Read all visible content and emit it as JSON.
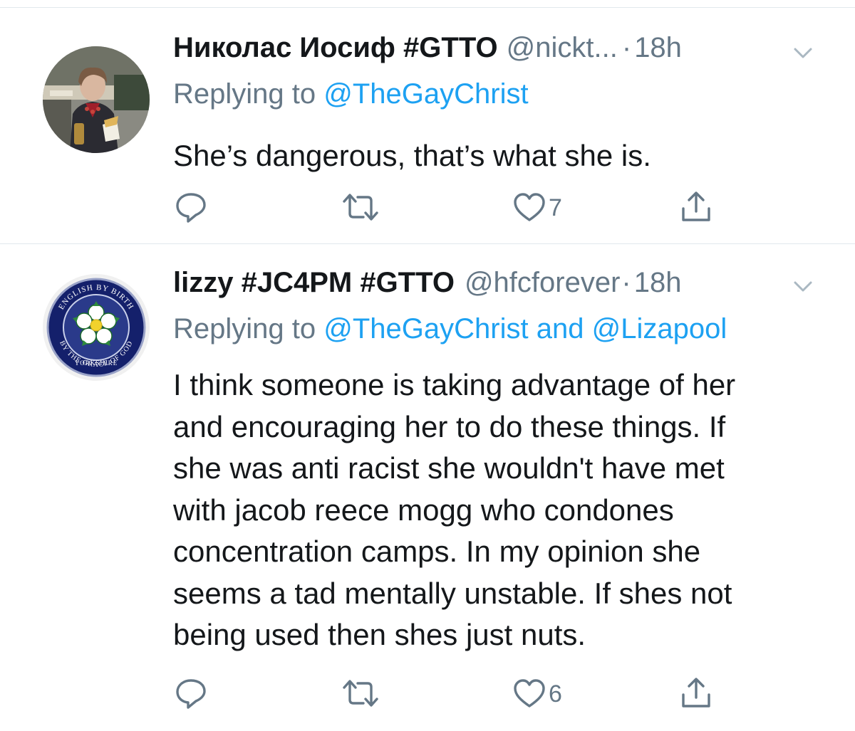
{
  "tweets": [
    {
      "display_name": "Николас Иосиф #GTTO",
      "handle": "@nickt...",
      "time": "18h",
      "reply_prefix": "Replying to",
      "mentions": [
        "@TheGayChrist"
      ],
      "conjunction": "",
      "body": "She’s dangerous, that’s what she is.",
      "avatar_icon": "profile-photo",
      "actions": {
        "reply_count": "",
        "retweet_count": "",
        "like_count": "7"
      }
    },
    {
      "display_name": "lizzy #JC4PM #GTTO",
      "handle": "@hfcforever",
      "time": "18h",
      "reply_prefix": "Replying to",
      "mentions": [
        "@TheGayChrist",
        "@Lizapool"
      ],
      "conjunction": "and",
      "body_lines": [
        "I think someone is taking advantage of her",
        "and encouraging her to do these things. If",
        "she was anti racist she wouldn't have met",
        "with jacob reece mogg who condones",
        "concentration camps. In my opinion she",
        "seems a tad mentally unstable. If shes not",
        "being used then shes just nuts."
      ],
      "avatar_icon": "yorkshire-rose-badge",
      "avatar_text": {
        "top": "ENGLISH BY BIRTH",
        "middle": "YORKSHIRE",
        "bottom": "BY THE GRACE OF GOD"
      },
      "actions": {
        "reply_count": "",
        "retweet_count": "",
        "like_count": "6"
      }
    }
  ],
  "icons": {
    "reply": "reply-icon",
    "retweet": "retweet-icon",
    "like": "heart-icon",
    "share": "share-icon",
    "caret": "chevron-down-icon"
  },
  "colors": {
    "link": "#1da1f2",
    "secondary_text": "#657786",
    "primary_text": "#14171a",
    "divider": "#e1e8ed",
    "badge_navy": "#14206b"
  }
}
